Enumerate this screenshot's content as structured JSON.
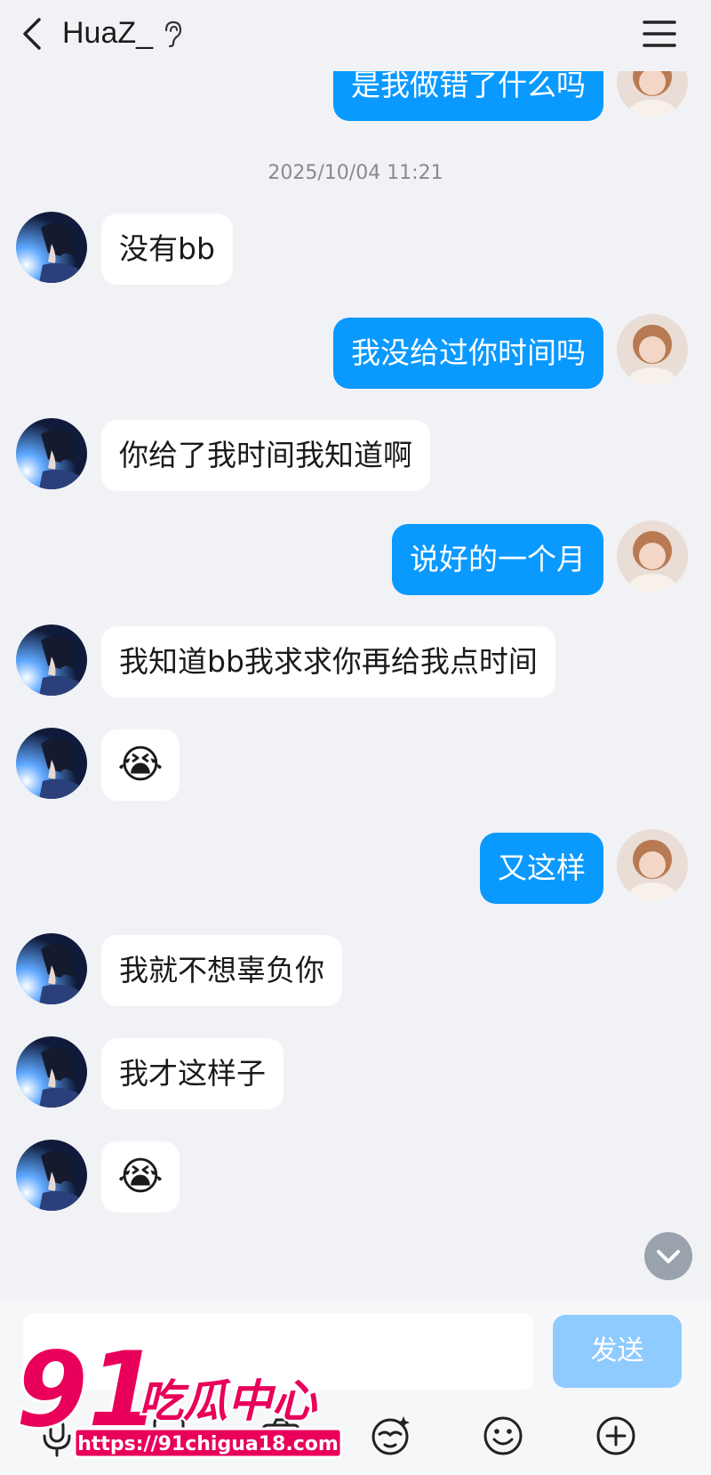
{
  "header": {
    "title": "HuaZ_",
    "back_icon": "back-arrow-icon",
    "ear_icon": "ear-icon",
    "menu_icon": "hamburger-menu-icon"
  },
  "timestamp": "2025/10/04 11:21",
  "messages": [
    {
      "side": "out",
      "text": "是我做错了什么吗"
    },
    {
      "side": "in",
      "text": "没有bb"
    },
    {
      "side": "out",
      "text": "我没给过你时间吗"
    },
    {
      "side": "in",
      "text": "你给了我时间我知道啊"
    },
    {
      "side": "out",
      "text": "说好的一个月"
    },
    {
      "side": "in",
      "text": "我知道bb我求求你再给我点时间"
    },
    {
      "side": "in",
      "text": "😭"
    },
    {
      "side": "out",
      "text": "又这样"
    },
    {
      "side": "in",
      "text": "我就不想辜负你"
    },
    {
      "side": "in",
      "text": "我才这样子"
    },
    {
      "side": "in",
      "text": "😭"
    }
  ],
  "composer": {
    "send_label": "发送",
    "tools": [
      "mic-icon",
      "hongbao-icon",
      "camera-icon",
      "sticker-icon",
      "emoji-icon",
      "plus-icon"
    ]
  },
  "watermark": {
    "brand": "91吃瓜中心",
    "url": "https://91chigua18.com"
  },
  "colors": {
    "outgoing_bubble": "#0a99ff",
    "incoming_bubble": "#ffffff",
    "background": "#f1f2f5",
    "send_button": "#8fcbff"
  }
}
